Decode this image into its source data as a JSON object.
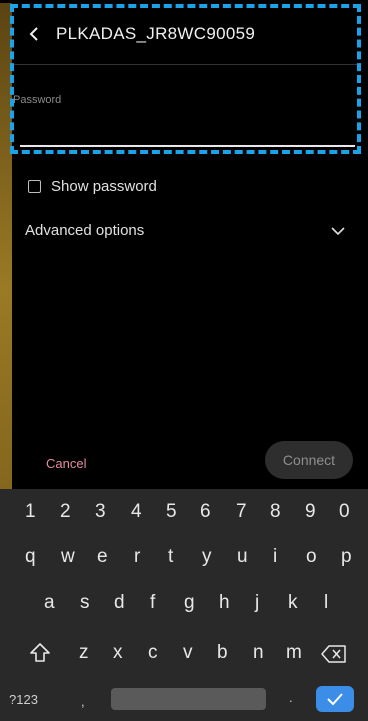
{
  "header": {
    "title": "PLKADAS_JR8WC90059"
  },
  "password": {
    "label": "Password",
    "value": ""
  },
  "show_password": {
    "label": "Show password",
    "checked": false
  },
  "advanced": {
    "label": "Advanced options"
  },
  "actions": {
    "cancel_label": "Cancel",
    "connect_label": "Connect"
  },
  "keyboard": {
    "numbers": [
      "1",
      "2",
      "3",
      "4",
      "5",
      "6",
      "7",
      "8",
      "9",
      "0"
    ],
    "row1": [
      "q",
      "w",
      "e",
      "r",
      "t",
      "y",
      "u",
      "i",
      "o",
      "p"
    ],
    "row2": [
      "a",
      "s",
      "d",
      "f",
      "g",
      "h",
      "j",
      "k",
      "l"
    ],
    "row3": [
      "z",
      "x",
      "c",
      "v",
      "b",
      "n",
      "m"
    ],
    "symbols_label": "?123",
    "comma_label": ",",
    "period_label": "."
  },
  "colors": {
    "accent_dash": "#1aa3e8",
    "cancel": "#e48aa0",
    "enter": "#3b8de8"
  }
}
